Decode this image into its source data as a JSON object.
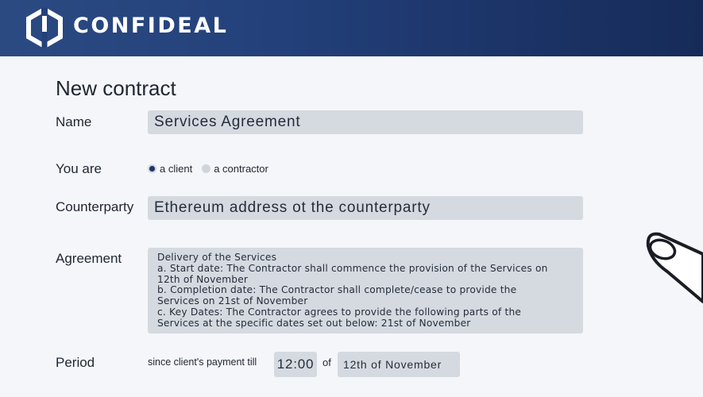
{
  "header": {
    "logo_icon": "confideal-logo-icon",
    "brand": "CONFIDEAL",
    "colors": {
      "header_bg": "#23407a",
      "accent": "#1e3464",
      "field_bg": "#d5dae1"
    }
  },
  "form": {
    "title": "New contract",
    "name": {
      "label": "Name",
      "value": "Services Agreement"
    },
    "role": {
      "label": "You are",
      "options": [
        {
          "label": "a client",
          "selected": true
        },
        {
          "label": "a contractor",
          "selected": false
        }
      ]
    },
    "counterparty": {
      "label": "Counterparty",
      "placeholder": "Ethereum address ot the counterparty"
    },
    "agreement": {
      "label": "Agreement",
      "lines": [
        "Delivery of the Services",
        "a.  Start date: The Contractor shall commence the provision of the Services on",
        "12th of November",
        "b.  Completion date: The Contractor  shall complete/cease to provide the",
        "Services on 21st of November",
        "c.  Key Dates: The Contractor agrees to provide the following parts of the",
        "Services at the specific dates set out below: 21st of November"
      ]
    },
    "period": {
      "label": "Period",
      "prefix": "since client's payment till",
      "time": "12:00",
      "of": "of",
      "date": "12th of November"
    }
  }
}
